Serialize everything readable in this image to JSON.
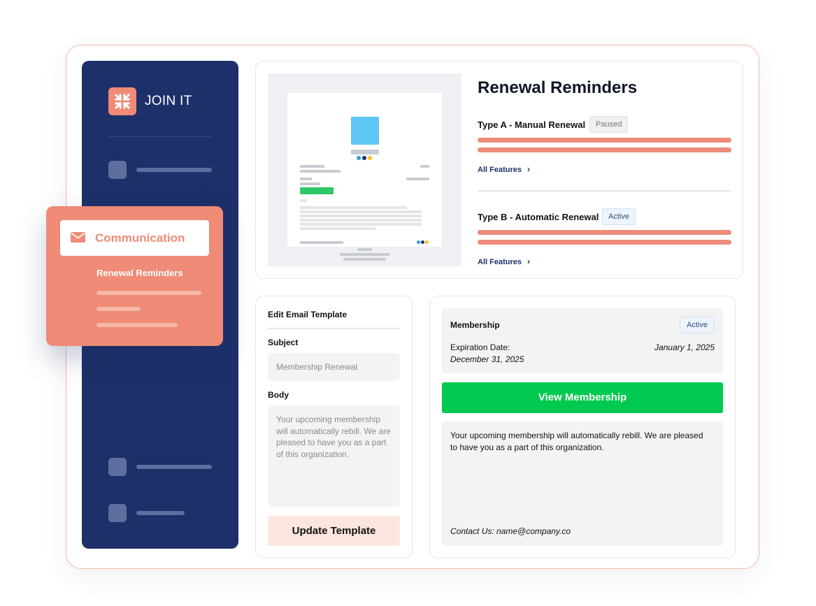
{
  "brand": {
    "name": "JOIN IT",
    "accent_color": "#ef8b76",
    "sidebar_color": "#1d3069",
    "logo_icon": "compress-arrows-icon"
  },
  "sidebar_card": {
    "active_item_label": "Communication",
    "active_item_icon": "mail-icon",
    "sub_item_label": "Renewal Reminders"
  },
  "reminders": {
    "title": "Renewal Reminders",
    "types": [
      {
        "label": "Type A - Manual Renewal",
        "status": "Paused",
        "link": "All Features"
      },
      {
        "label": "Type B - Automatic Renewal",
        "status": "Active",
        "link": "All Features"
      }
    ]
  },
  "edit_template": {
    "title": "Edit Email Template",
    "subject_label": "Subject",
    "subject_placeholder": "Membership Renewal",
    "body_label": "Body",
    "body_placeholder": "Your upcoming membership will automatically rebill. We are pleased to have you as a part of this organization.",
    "update_button": "Update Template"
  },
  "membership_preview": {
    "title": "Membership",
    "status": "Active",
    "expiration_label": "Expiration Date:",
    "expiration_date": "December 31, 2025",
    "start_date": "January 1, 2025",
    "view_button": "View Membership",
    "body_text": "Your upcoming membership will automatically rebill. We are pleased to have you as a part of this organization.",
    "contact": "Contact Us: name@company.co",
    "button_color": "#00c94f"
  }
}
